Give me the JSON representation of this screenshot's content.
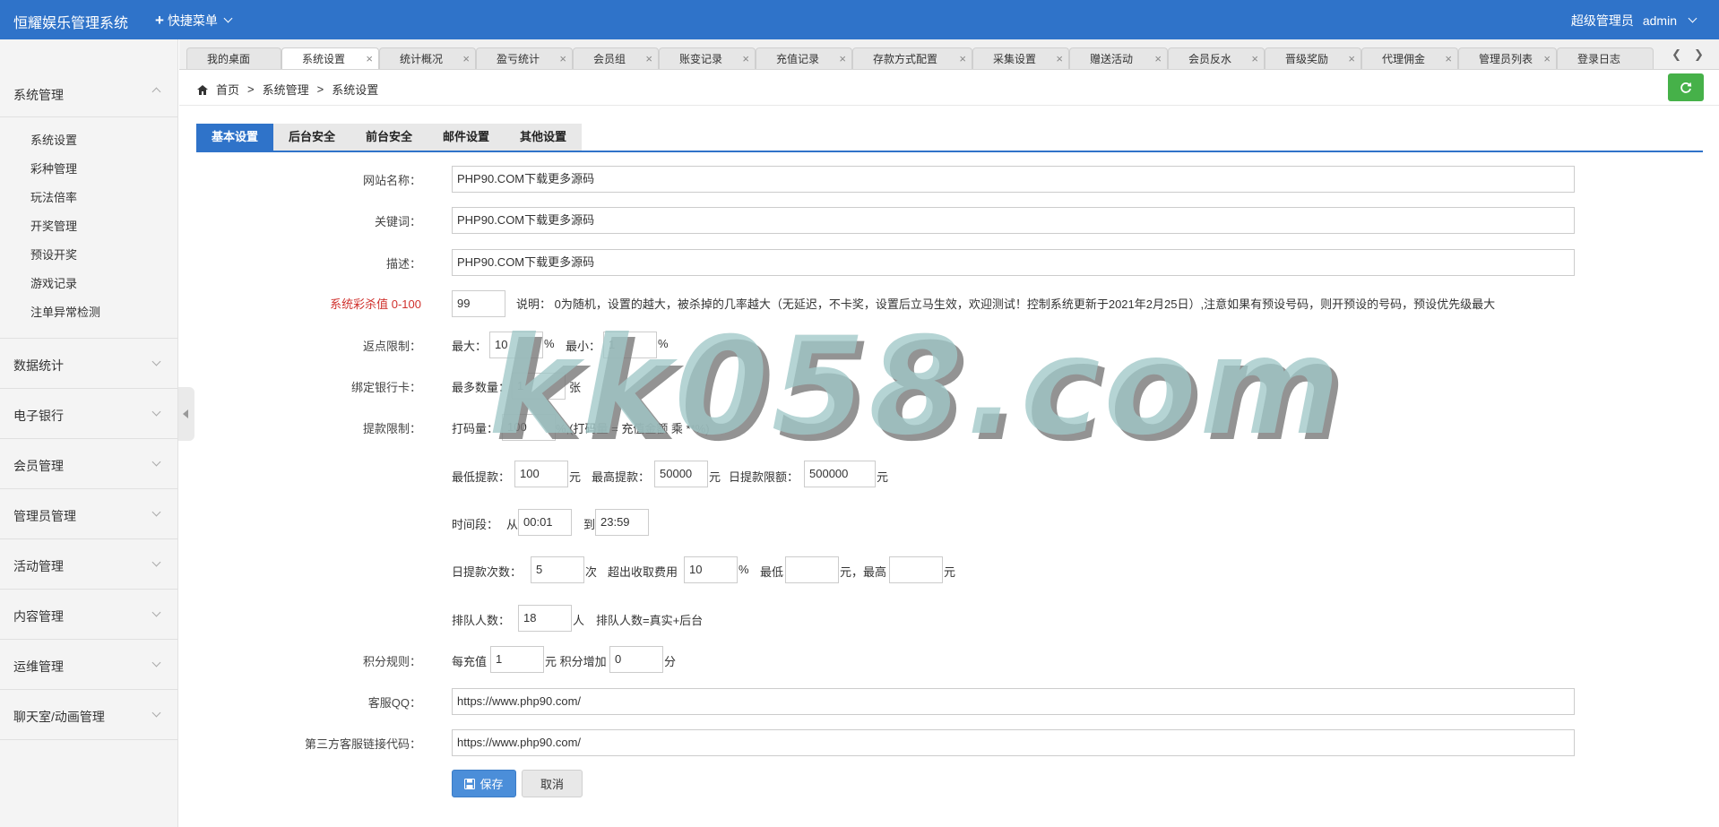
{
  "app": {
    "title": "恒耀娱乐管理系统",
    "quick_menu": "快捷菜单",
    "user_role": "超级管理员",
    "username": "admin"
  },
  "sidebar": {
    "groups": [
      {
        "label": "系统管理",
        "items": [
          "系统设置",
          "彩种管理",
          "玩法倍率",
          "开奖管理",
          "预设开奖",
          "游戏记录",
          "注单异常检测"
        ]
      },
      {
        "label": "数据统计"
      },
      {
        "label": "电子银行"
      },
      {
        "label": "会员管理"
      },
      {
        "label": "管理员管理"
      },
      {
        "label": "活动管理"
      },
      {
        "label": "内容管理"
      },
      {
        "label": "运维管理"
      },
      {
        "label": "聊天室/动画管理"
      }
    ]
  },
  "tabs": [
    "我的桌面",
    "系统设置",
    "统计概况",
    "盈亏统计",
    "会员组",
    "账变记录",
    "充值记录",
    "存款方式配置",
    "采集设置",
    "赠送活动",
    "会员反水",
    "晋级奖励",
    "代理佣金",
    "管理员列表",
    "登录日志"
  ],
  "tabs_close": "×",
  "breadcrumb": {
    "home": "首页",
    "sep": ">",
    "level1": "系统管理",
    "level2": "系统设置"
  },
  "settings_tabs": [
    "基本设置",
    "后台安全",
    "前台安全",
    "邮件设置",
    "其他设置"
  ],
  "form": {
    "site_name": {
      "label": "网站名称：",
      "value": "PHP90.COM下载更多源码"
    },
    "keywords": {
      "label": "关键词：",
      "value": "PHP90.COM下载更多源码"
    },
    "description": {
      "label": "描述：",
      "value": "PHP90.COM下载更多源码"
    },
    "kill_rate": {
      "label": "系统彩杀值 0-100",
      "value": "99",
      "note": "说明：  0为随机，设置的越大，被杀掉的几率越大（无延迟，不卡奖，设置后立马生效，欢迎测试！控制系统更新于2021年2月25日）,注意如果有预设号码，则开预设的号码，预设优先级最大"
    },
    "rebate_limit": {
      "label": "返点限制：",
      "max_label": "最大：",
      "max_value": "10",
      "min_label": "最小：",
      "min_value": "1",
      "unit": "%"
    },
    "bind_card": {
      "label": "绑定银行卡：",
      "prefix": "最多数量：",
      "value": "1",
      "unit": "张"
    },
    "withdraw": {
      "label": "提款限制：",
      "bet_label": "打码量：",
      "bet_value": "100",
      "bet_note": "%,(打码量 = 充值金额 乘 **%)",
      "min_label": "最低提款：",
      "min_value": "100",
      "unit_yuan": "元",
      "max_label": "最高提款：",
      "max_value": "50000",
      "daily_label": "日提款限额：",
      "daily_value": "500000",
      "period_label": "时间段：",
      "from_label": "从",
      "from_value": "00:01",
      "to_label": "到",
      "to_value": "23:59",
      "count_label": "日提款次数：",
      "count_value": "5",
      "count_unit": "次",
      "fee_label": "超出收取费用",
      "fee_value": "10",
      "fee_unit": "%",
      "fee_min_label": "最低",
      "fee_min_value": "",
      "fee_max_label": "元，最高",
      "fee_max_value": "",
      "fee_max_unit": "元",
      "queue_label": "排队人数：",
      "queue_value": "18",
      "queue_unit": "人",
      "queue_note": "排队人数=真实+后台"
    },
    "points": {
      "label": "积分规则：",
      "per_label": "每充值",
      "per_value": "1",
      "per_unit": "元 积分增加",
      "add_value": "0",
      "add_unit": "分"
    },
    "service_qq": {
      "label": "客服QQ：",
      "value": "https://www.php90.com/"
    },
    "third_service": {
      "label": "第三方客服链接代码：",
      "value": "https://www.php90.com/"
    }
  },
  "buttons": {
    "save": "保存",
    "cancel": "取消"
  },
  "watermark": "kk058.com",
  "colors": {
    "primary": "#2f73c9",
    "refresh": "#46b149",
    "red_label": "#d0312d"
  }
}
